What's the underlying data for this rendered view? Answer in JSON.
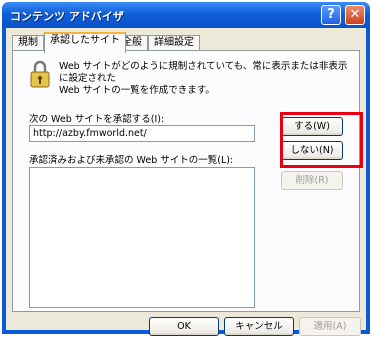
{
  "window": {
    "title": "コンテンツ アドバイザ",
    "help_glyph": "?",
    "close_glyph": "✕"
  },
  "tabs": [
    {
      "label": "規制"
    },
    {
      "label": "承認したサイト"
    },
    {
      "label": "全般"
    },
    {
      "label": "詳細設定"
    }
  ],
  "panel": {
    "description_line1": "Web サイトがどのように規制されていても、常に表示または非表示に設定された",
    "description_line2": "Web サイトの一覧を作成できます。",
    "approve_label": "次の Web サイトを承認する(I):",
    "url_value": "http://azby.fmworld.net/",
    "always_button": "する(W)",
    "never_button": "しない(N)",
    "list_label": "承認済みおよび未承認の Web サイトの一覧(L):",
    "remove_button": "削除(R)"
  },
  "footer": {
    "ok": "OK",
    "cancel": "キャンセル",
    "apply": "適用(A)"
  },
  "colors": {
    "highlight": "#e60012",
    "titlebar": "#0a52c9"
  }
}
